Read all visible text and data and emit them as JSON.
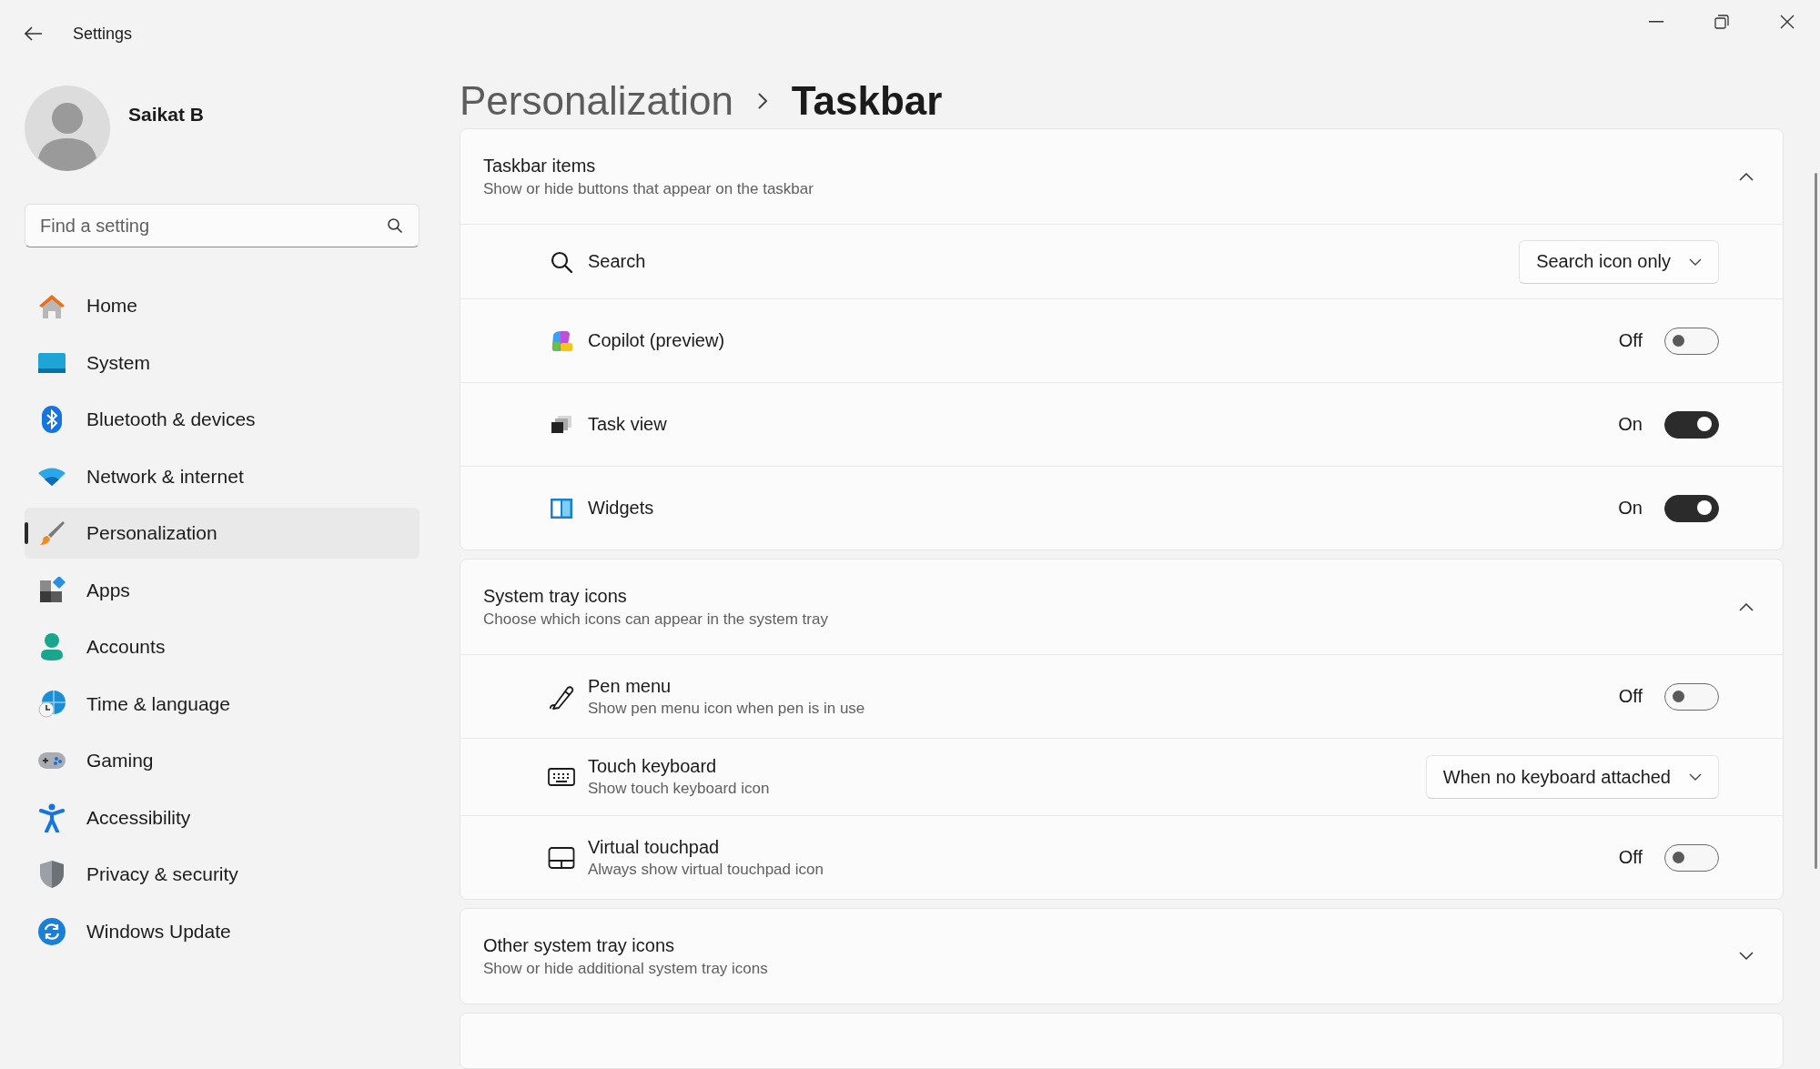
{
  "window": {
    "title": "Settings"
  },
  "user": {
    "name": "Saikat B"
  },
  "search": {
    "placeholder": "Find a setting"
  },
  "nav": [
    {
      "label": "Home",
      "selected": false
    },
    {
      "label": "System",
      "selected": false
    },
    {
      "label": "Bluetooth & devices",
      "selected": false
    },
    {
      "label": "Network & internet",
      "selected": false
    },
    {
      "label": "Personalization",
      "selected": true
    },
    {
      "label": "Apps",
      "selected": false
    },
    {
      "label": "Accounts",
      "selected": false
    },
    {
      "label": "Time & language",
      "selected": false
    },
    {
      "label": "Gaming",
      "selected": false
    },
    {
      "label": "Accessibility",
      "selected": false
    },
    {
      "label": "Privacy & security",
      "selected": false
    },
    {
      "label": "Windows Update",
      "selected": false
    }
  ],
  "breadcrumb": [
    {
      "label": "Personalization",
      "current": false
    },
    {
      "label": "Taskbar",
      "current": true
    }
  ],
  "sections": [
    {
      "title": "Taskbar items",
      "subtitle": "Show or hide buttons that appear on the taskbar",
      "expanded": true,
      "rows": [
        {
          "kind": "dropdown",
          "label": "Search",
          "value": "Search icon only"
        },
        {
          "kind": "toggle",
          "label": "Copilot (preview)",
          "on": false,
          "state_label": "Off"
        },
        {
          "kind": "toggle",
          "label": "Task view",
          "on": true,
          "state_label": "On"
        },
        {
          "kind": "toggle",
          "label": "Widgets",
          "on": true,
          "state_label": "On"
        }
      ]
    },
    {
      "title": "System tray icons",
      "subtitle": "Choose which icons can appear in the system tray",
      "expanded": true,
      "rows": [
        {
          "kind": "toggle",
          "label": "Pen menu",
          "description": "Show pen menu icon when pen is in use",
          "on": false,
          "state_label": "Off"
        },
        {
          "kind": "dropdown",
          "label": "Touch keyboard",
          "description": "Show touch keyboard icon",
          "value": "When no keyboard attached"
        },
        {
          "kind": "toggle",
          "label": "Virtual touchpad",
          "description": "Always show virtual touchpad icon",
          "on": false,
          "state_label": "Off"
        }
      ]
    },
    {
      "title": "Other system tray icons",
      "subtitle": "Show or hide additional system tray icons",
      "expanded": false
    }
  ]
}
